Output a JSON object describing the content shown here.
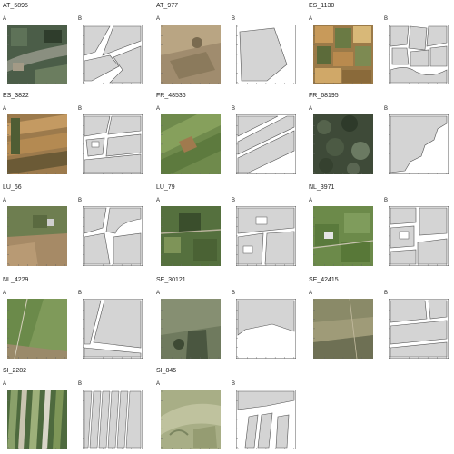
{
  "figure": {
    "cells": [
      {
        "id": "AT_5895",
        "panel_a_label": "A",
        "panel_b_label": "B",
        "imagery": "mixed-green-dark"
      },
      {
        "id": "AT_977",
        "panel_a_label": "A",
        "panel_b_label": "B",
        "imagery": "dry-brown"
      },
      {
        "id": "ES_1130",
        "panel_a_label": "A",
        "panel_b_label": "B",
        "imagery": "patchwork-orange"
      },
      {
        "id": "ES_3822",
        "panel_a_label": "A",
        "panel_b_label": "B",
        "imagery": "tan-stripes"
      },
      {
        "id": "FR_48536",
        "panel_a_label": "A",
        "panel_b_label": "B",
        "imagery": "green-field"
      },
      {
        "id": "FR_68195",
        "panel_a_label": "A",
        "panel_b_label": "B",
        "imagery": "dark-forest"
      },
      {
        "id": "LU_66",
        "panel_a_label": "A",
        "panel_b_label": "B",
        "imagery": "green-brown"
      },
      {
        "id": "LU_79",
        "panel_a_label": "A",
        "panel_b_label": "B",
        "imagery": "green-dark"
      },
      {
        "id": "NL_3971",
        "panel_a_label": "A",
        "panel_b_label": "B",
        "imagery": "green-village"
      },
      {
        "id": "NL_4229",
        "panel_a_label": "A",
        "panel_b_label": "B",
        "imagery": "green-road"
      },
      {
        "id": "SE_30121",
        "panel_a_label": "A",
        "panel_b_label": "B",
        "imagery": "grey-green"
      },
      {
        "id": "SE_42415",
        "panel_a_label": "A",
        "panel_b_label": "B",
        "imagery": "olive-dry"
      },
      {
        "id": "SI_2282",
        "panel_a_label": "A",
        "panel_b_label": "B",
        "imagery": "strips-green"
      },
      {
        "id": "SI_845",
        "panel_a_label": "A",
        "panel_b_label": "B",
        "imagery": "pale-green"
      }
    ]
  },
  "colors": {
    "parcel_fill": "#d4d4d4",
    "parcel_stroke": "#555555",
    "background_white": "#ffffff",
    "frame_stroke": "#333333"
  }
}
